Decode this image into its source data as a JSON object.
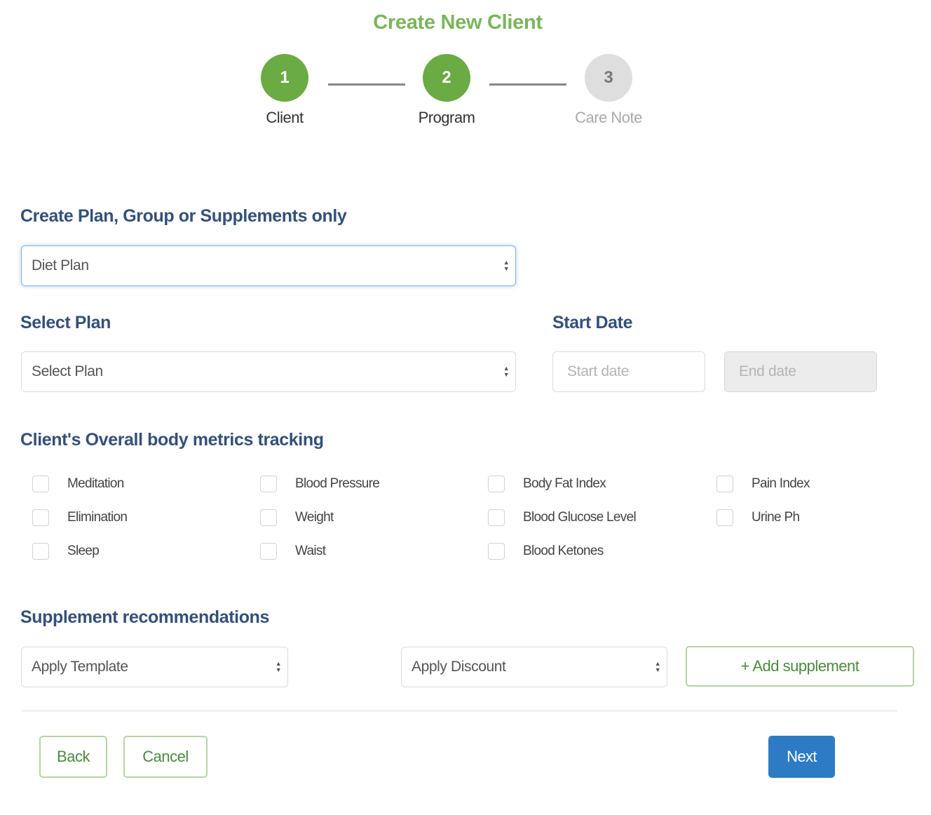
{
  "header": {
    "title": "Create New Client"
  },
  "stepper": {
    "steps": [
      {
        "number": "1",
        "label": "Client",
        "state": "complete"
      },
      {
        "number": "2",
        "label": "Program",
        "state": "current"
      },
      {
        "number": "3",
        "label": "Care Note",
        "state": "upcoming"
      }
    ]
  },
  "plan_type": {
    "label": "Create Plan, Group or Supplements only",
    "selected": "Diet Plan"
  },
  "select_plan": {
    "label": "Select Plan",
    "selected": "Select Plan"
  },
  "dates": {
    "label": "Start Date",
    "start_placeholder": "Start date",
    "end_placeholder": "End date"
  },
  "metrics": {
    "label": "Client's Overall body metrics tracking",
    "items": [
      {
        "label": "Meditation",
        "checked": false
      },
      {
        "label": "Elimination",
        "checked": false
      },
      {
        "label": "Sleep",
        "checked": false
      },
      {
        "label": "Blood Pressure",
        "checked": false
      },
      {
        "label": "Weight",
        "checked": false
      },
      {
        "label": "Waist",
        "checked": false
      },
      {
        "label": "Body Fat Index",
        "checked": false
      },
      {
        "label": "Blood Glucose Level",
        "checked": false
      },
      {
        "label": "Blood Ketones",
        "checked": false
      },
      {
        "label": "Pain Index",
        "checked": false
      },
      {
        "label": "Urine Ph",
        "checked": false
      }
    ]
  },
  "supplements": {
    "label": "Supplement recommendations",
    "template_selected": "Apply Template",
    "discount_selected": "Apply Discount",
    "add_label": "+ Add supplement"
  },
  "footer": {
    "back_label": "Back",
    "cancel_label": "Cancel",
    "next_label": "Next"
  },
  "icons": {
    "select_arrows": "updown-arrows-icon"
  },
  "colors": {
    "brand_green": "#6aab44",
    "heading_blue": "#34507a",
    "primary_blue": "#2d7bc4"
  }
}
